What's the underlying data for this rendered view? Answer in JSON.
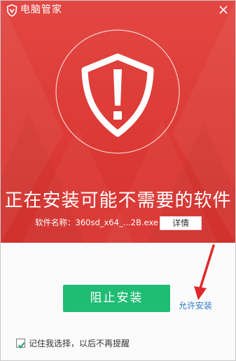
{
  "window": {
    "title": "电脑管家",
    "logo_icon": "shield-v-icon",
    "close_icon": "close-icon"
  },
  "alert": {
    "icon": "shield-exclamation-icon",
    "headline": "正在安装可能不需要的软件",
    "software_name": "软件名称：360sd_x64_...2B.exe",
    "details_label": "详情"
  },
  "actions": {
    "block_label": "阻止安装",
    "allow_label": "允许安装"
  },
  "remember": {
    "label": "记住我选择，以后不再提醒",
    "checked": true
  },
  "colors": {
    "header_red": "#dc3a35",
    "block_green": "#1fbc73",
    "link_blue": "#2f7ac9"
  }
}
